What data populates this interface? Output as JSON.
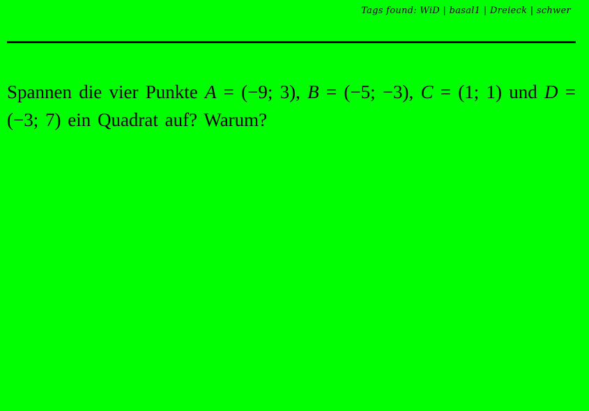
{
  "header": {
    "tags_line": "Tags found: WiD | basal1 | Dreieck | schwer"
  },
  "question": {
    "intro": "Spannen die vier Punkte ",
    "A_label": "A",
    "A_value": " = (−9; 3), ",
    "B_label": "B",
    "B_value": " = (−5; −3), ",
    "C_label": "C",
    "C_value": " = (1; 1) und ",
    "D_label": "D",
    "D_value": " = (−3; 7) ein Quadrat auf? Warum?"
  },
  "colors": {
    "background": "#00ff00",
    "text": "#000000"
  }
}
